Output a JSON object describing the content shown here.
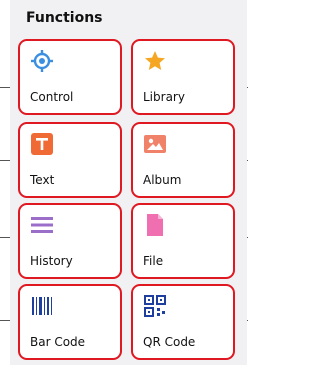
{
  "header": {
    "title": "Functions"
  },
  "cards": [
    {
      "label": "Control",
      "icon": "crosshair-icon",
      "color": "#3b8fe0"
    },
    {
      "label": "Library",
      "icon": "star-icon",
      "color": "#f5a623"
    },
    {
      "label": "Text",
      "icon": "text-t-icon",
      "color": "#f06a35"
    },
    {
      "label": "Album",
      "icon": "image-icon",
      "color": "#f0826a"
    },
    {
      "label": "History",
      "icon": "menu-lines-icon",
      "color": "#9b6fc9"
    },
    {
      "label": "File",
      "icon": "file-icon",
      "color": "#f06fb0"
    },
    {
      "label": "Bar Code",
      "icon": "barcode-icon",
      "color": "#1f3f9e"
    },
    {
      "label": "QR Code",
      "icon": "qr-code-icon",
      "color": "#1f3f9e"
    }
  ]
}
